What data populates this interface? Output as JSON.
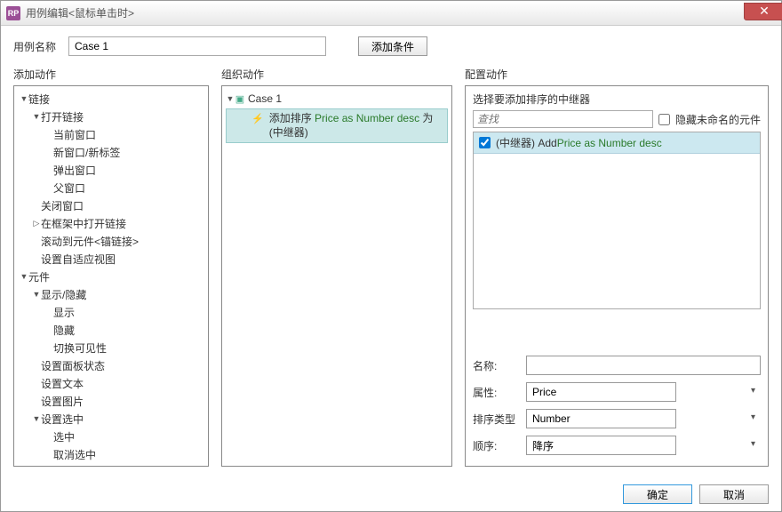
{
  "window": {
    "title": "用例编辑<鼠标单击时>",
    "app_icon": "RP"
  },
  "toolbar": {
    "case_name_label": "用例名称",
    "case_name_value": "Case 1",
    "add_condition": "添加条件"
  },
  "columns": {
    "add_action": "添加动作",
    "organize_action": "组织动作",
    "configure_action": "配置动作"
  },
  "tree": [
    {
      "label": "链接",
      "indent": 0,
      "caret": "open"
    },
    {
      "label": "打开链接",
      "indent": 1,
      "caret": "open"
    },
    {
      "label": "当前窗口",
      "indent": 2,
      "caret": "none"
    },
    {
      "label": "新窗口/新标签",
      "indent": 2,
      "caret": "none"
    },
    {
      "label": "弹出窗口",
      "indent": 2,
      "caret": "none"
    },
    {
      "label": "父窗口",
      "indent": 2,
      "caret": "none"
    },
    {
      "label": "关闭窗口",
      "indent": 1,
      "caret": "none"
    },
    {
      "label": "在框架中打开链接",
      "indent": 1,
      "caret": "closed"
    },
    {
      "label": "滚动到元件<锚链接>",
      "indent": 1,
      "caret": "none"
    },
    {
      "label": "设置自适应视图",
      "indent": 1,
      "caret": "none"
    },
    {
      "label": "元件",
      "indent": 0,
      "caret": "open"
    },
    {
      "label": "显示/隐藏",
      "indent": 1,
      "caret": "open"
    },
    {
      "label": "显示",
      "indent": 2,
      "caret": "none"
    },
    {
      "label": "隐藏",
      "indent": 2,
      "caret": "none"
    },
    {
      "label": "切换可见性",
      "indent": 2,
      "caret": "none"
    },
    {
      "label": "设置面板状态",
      "indent": 1,
      "caret": "none"
    },
    {
      "label": "设置文本",
      "indent": 1,
      "caret": "none"
    },
    {
      "label": "设置图片",
      "indent": 1,
      "caret": "none"
    },
    {
      "label": "设置选中",
      "indent": 1,
      "caret": "open"
    },
    {
      "label": "选中",
      "indent": 2,
      "caret": "none"
    },
    {
      "label": "取消选中",
      "indent": 2,
      "caret": "none"
    }
  ],
  "organize": {
    "case_label": "Case 1",
    "action_prefix": "添加排序 ",
    "action_expr": "Price as Number desc",
    "action_suffix": " 为 (中继器)"
  },
  "configure": {
    "select_repeater": "选择要添加排序的中继器",
    "search_placeholder": "查找",
    "hide_unnamed": "隐藏未命名的元件",
    "item_prefix": "(中继器) Add ",
    "item_expr": "Price as Number desc",
    "form": {
      "name_label": "名称:",
      "name_value": "",
      "attr_label": "属性:",
      "attr_value": "Price",
      "sort_type_label": "排序类型",
      "sort_type_value": "Number",
      "order_label": "顺序:",
      "order_value": "降序"
    }
  },
  "footer": {
    "ok": "确定",
    "cancel": "取消"
  }
}
